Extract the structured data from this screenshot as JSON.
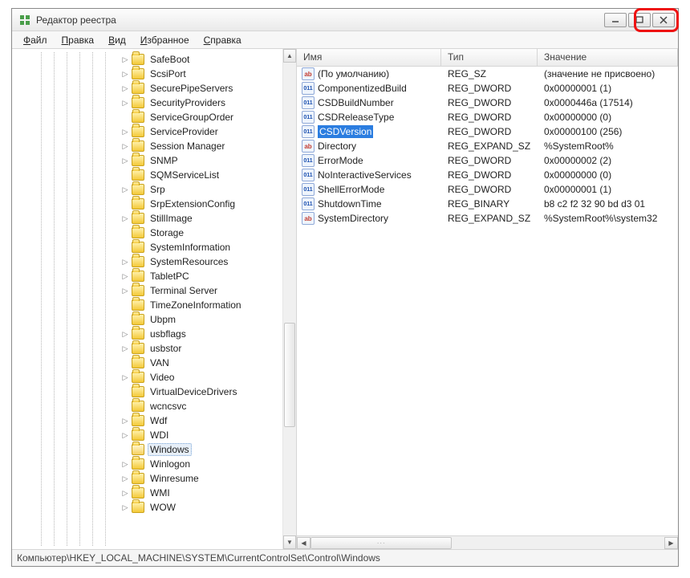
{
  "window": {
    "title": "Редактор реестра"
  },
  "menubar": {
    "items": [
      {
        "u": "Ф",
        "rest": "айл"
      },
      {
        "u": "П",
        "rest": "равка"
      },
      {
        "u": "В",
        "rest": "ид"
      },
      {
        "u": "И",
        "rest": "збранное"
      },
      {
        "u": "С",
        "rest": "правка"
      }
    ]
  },
  "tree": {
    "items": [
      {
        "label": "SafeBoot",
        "expandable": true
      },
      {
        "label": "ScsiPort",
        "expandable": true
      },
      {
        "label": "SecurePipeServers",
        "expandable": true
      },
      {
        "label": "SecurityProviders",
        "expandable": true
      },
      {
        "label": "ServiceGroupOrder",
        "expandable": false
      },
      {
        "label": "ServiceProvider",
        "expandable": true
      },
      {
        "label": "Session Manager",
        "expandable": true
      },
      {
        "label": "SNMP",
        "expandable": true
      },
      {
        "label": "SQMServiceList",
        "expandable": false
      },
      {
        "label": "Srp",
        "expandable": true
      },
      {
        "label": "SrpExtensionConfig",
        "expandable": false
      },
      {
        "label": "StillImage",
        "expandable": true
      },
      {
        "label": "Storage",
        "expandable": false
      },
      {
        "label": "SystemInformation",
        "expandable": false
      },
      {
        "label": "SystemResources",
        "expandable": true
      },
      {
        "label": "TabletPC",
        "expandable": true
      },
      {
        "label": "Terminal Server",
        "expandable": true
      },
      {
        "label": "TimeZoneInformation",
        "expandable": false
      },
      {
        "label": "Ubpm",
        "expandable": false
      },
      {
        "label": "usbflags",
        "expandable": true
      },
      {
        "label": "usbstor",
        "expandable": true
      },
      {
        "label": "VAN",
        "expandable": false
      },
      {
        "label": "Video",
        "expandable": true
      },
      {
        "label": "VirtualDeviceDrivers",
        "expandable": false
      },
      {
        "label": "wcncsvc",
        "expandable": false
      },
      {
        "label": "Wdf",
        "expandable": true
      },
      {
        "label": "WDI",
        "expandable": true
      },
      {
        "label": "Windows",
        "expandable": false,
        "selected": true,
        "open": true
      },
      {
        "label": "Winlogon",
        "expandable": true
      },
      {
        "label": "Winresume",
        "expandable": true
      },
      {
        "label": "WMI",
        "expandable": true
      },
      {
        "label": "WOW",
        "expandable": true
      }
    ]
  },
  "columns": {
    "name": "Имя",
    "type": "Тип",
    "data": "Значение"
  },
  "values": [
    {
      "icon": "str",
      "name": "(По умолчанию)",
      "type": "REG_SZ",
      "data": "(значение не присвоено)"
    },
    {
      "icon": "num",
      "name": "ComponentizedBuild",
      "type": "REG_DWORD",
      "data": "0x00000001 (1)"
    },
    {
      "icon": "num",
      "name": "CSDBuildNumber",
      "type": "REG_DWORD",
      "data": "0x0000446a (17514)"
    },
    {
      "icon": "num",
      "name": "CSDReleaseType",
      "type": "REG_DWORD",
      "data": "0x00000000 (0)"
    },
    {
      "icon": "num",
      "name": "CSDVersion",
      "type": "REG_DWORD",
      "data": "0x00000100 (256)",
      "selected": true
    },
    {
      "icon": "str",
      "name": "Directory",
      "type": "REG_EXPAND_SZ",
      "data": "%SystemRoot%"
    },
    {
      "icon": "num",
      "name": "ErrorMode",
      "type": "REG_DWORD",
      "data": "0x00000002 (2)"
    },
    {
      "icon": "num",
      "name": "NoInteractiveServices",
      "type": "REG_DWORD",
      "data": "0x00000000 (0)"
    },
    {
      "icon": "num",
      "name": "ShellErrorMode",
      "type": "REG_DWORD",
      "data": "0x00000001 (1)"
    },
    {
      "icon": "num",
      "name": "ShutdownTime",
      "type": "REG_BINARY",
      "data": "b8 c2 f2 32 90 bd d3 01"
    },
    {
      "icon": "str",
      "name": "SystemDirectory",
      "type": "REG_EXPAND_SZ",
      "data": "%SystemRoot%\\system32"
    }
  ],
  "statusbar": {
    "path": "Компьютер\\HKEY_LOCAL_MACHINE\\SYSTEM\\CurrentControlSet\\Control\\Windows"
  }
}
